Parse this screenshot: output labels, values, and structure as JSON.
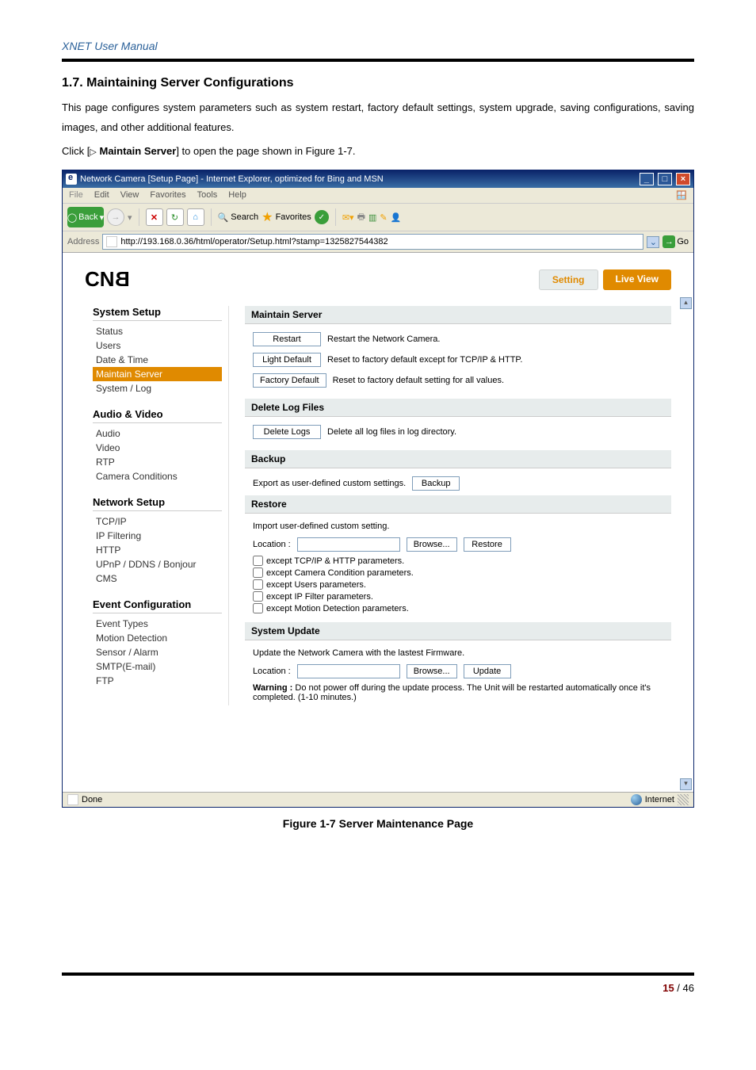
{
  "doc": {
    "header": "XNET User Manual",
    "section_heading": "1.7. Maintaining Server Configurations",
    "para1": "This page configures system parameters such as system restart, factory default settings, system upgrade, saving configurations, saving images, and other additional features.",
    "click_prefix": "Click [",
    "click_item": "Maintain Server",
    "click_suffix": "] to open the page shown in Figure 1-7.",
    "figure_caption": "Figure 1-7 Server Maintenance Page",
    "page_cur": "15",
    "page_sep": " / ",
    "page_total": "46"
  },
  "ie": {
    "title": "Network Camera [Setup Page] - Internet Explorer, optimized for Bing and MSN",
    "menu": {
      "file": "File",
      "edit": "Edit",
      "view": "View",
      "favorites": "Favorites",
      "tools": "Tools",
      "help": "Help"
    },
    "toolbar": {
      "back": "Back",
      "search": "Search",
      "favorites": "Favorites"
    },
    "addr": {
      "label": "Address",
      "url": "http://193.168.0.36/html/operator/Setup.html?stamp=1325827544382",
      "go": "Go"
    },
    "status": {
      "done": "Done",
      "zone": "Internet"
    }
  },
  "page": {
    "tabs": {
      "setting": "Setting",
      "live": "Live View"
    },
    "sidebar": {
      "g1": {
        "head": "System Setup",
        "items": [
          "Status",
          "Users",
          "Date & Time",
          "Maintain Server",
          "System / Log"
        ]
      },
      "g2": {
        "head": "Audio & Video",
        "items": [
          "Audio",
          "Video",
          "RTP",
          "Camera Conditions"
        ]
      },
      "g3": {
        "head": "Network Setup",
        "items": [
          "TCP/IP",
          "IP Filtering",
          "HTTP",
          "UPnP / DDNS / Bonjour",
          "CMS"
        ]
      },
      "g4": {
        "head": "Event Configuration",
        "items": [
          "Event Types",
          "Motion Detection",
          "Sensor / Alarm",
          "SMTP(E-mail)",
          "FTP"
        ]
      }
    },
    "maintain": {
      "head": "Maintain Server",
      "restart_btn": "Restart",
      "restart_desc": "Restart the Network Camera.",
      "light_btn": "Light Default",
      "light_desc": "Reset to factory default except for TCP/IP & HTTP.",
      "factory_btn": "Factory Default",
      "factory_desc": "Reset to factory default setting for all values."
    },
    "deletelogs": {
      "head": "Delete Log Files",
      "btn": "Delete Logs",
      "desc": "Delete all log files in log directory."
    },
    "backup": {
      "head": "Backup",
      "exp_desc": "Export as user-defined custom settings.",
      "exp_btn": "Backup",
      "restore_head": "Restore",
      "imp_desc": "Import user-defined custom setting.",
      "loc_label": "Location :",
      "browse_btn": "Browse...",
      "restore_btn": "Restore",
      "chk1": "except TCP/IP & HTTP parameters.",
      "chk2": "except Camera Condition parameters.",
      "chk3": "except Users parameters.",
      "chk4": "except IP Filter parameters.",
      "chk5": "except Motion Detection parameters."
    },
    "update": {
      "head": "System Update",
      "line1": "Update the Network Camera with the lastest Firmware.",
      "loc_label": "Location :",
      "browse_btn": "Browse...",
      "update_btn": "Update",
      "warn_label": "Warning :",
      "warn_text": " Do not power off during the update process. The Unit will be restarted automatically once it's completed. (1-10 minutes.)"
    }
  }
}
